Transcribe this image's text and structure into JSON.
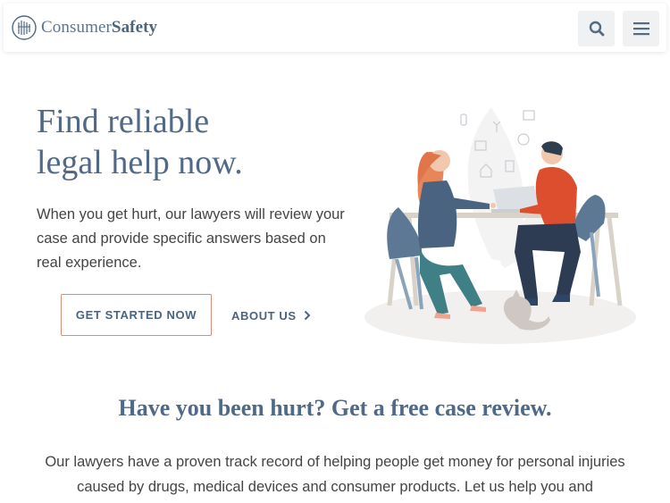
{
  "header": {
    "logo_light": "Consumer",
    "logo_bold": "Safety",
    "search_icon": "search-icon",
    "menu_icon": "hamburger-menu-icon"
  },
  "hero": {
    "title_line1": "Find reliable",
    "title_line2": "legal help now.",
    "body": "When you get hurt, our lawyers will review your case and provide specific answers based on real experience.",
    "cta_label": "GET STARTED NOW",
    "about_label": "ABOUT US"
  },
  "section": {
    "title": "Have you been hurt? Get a free case review.",
    "body": "Our lawyers have a proven track record of helping people get money for personal injuries caused by drugs, medical devices and consumer products. Let us help you and"
  },
  "colors": {
    "brand_blue": "#4f6987",
    "cta_border": "#e08a74",
    "header_button_bg": "#f0f1f2"
  }
}
